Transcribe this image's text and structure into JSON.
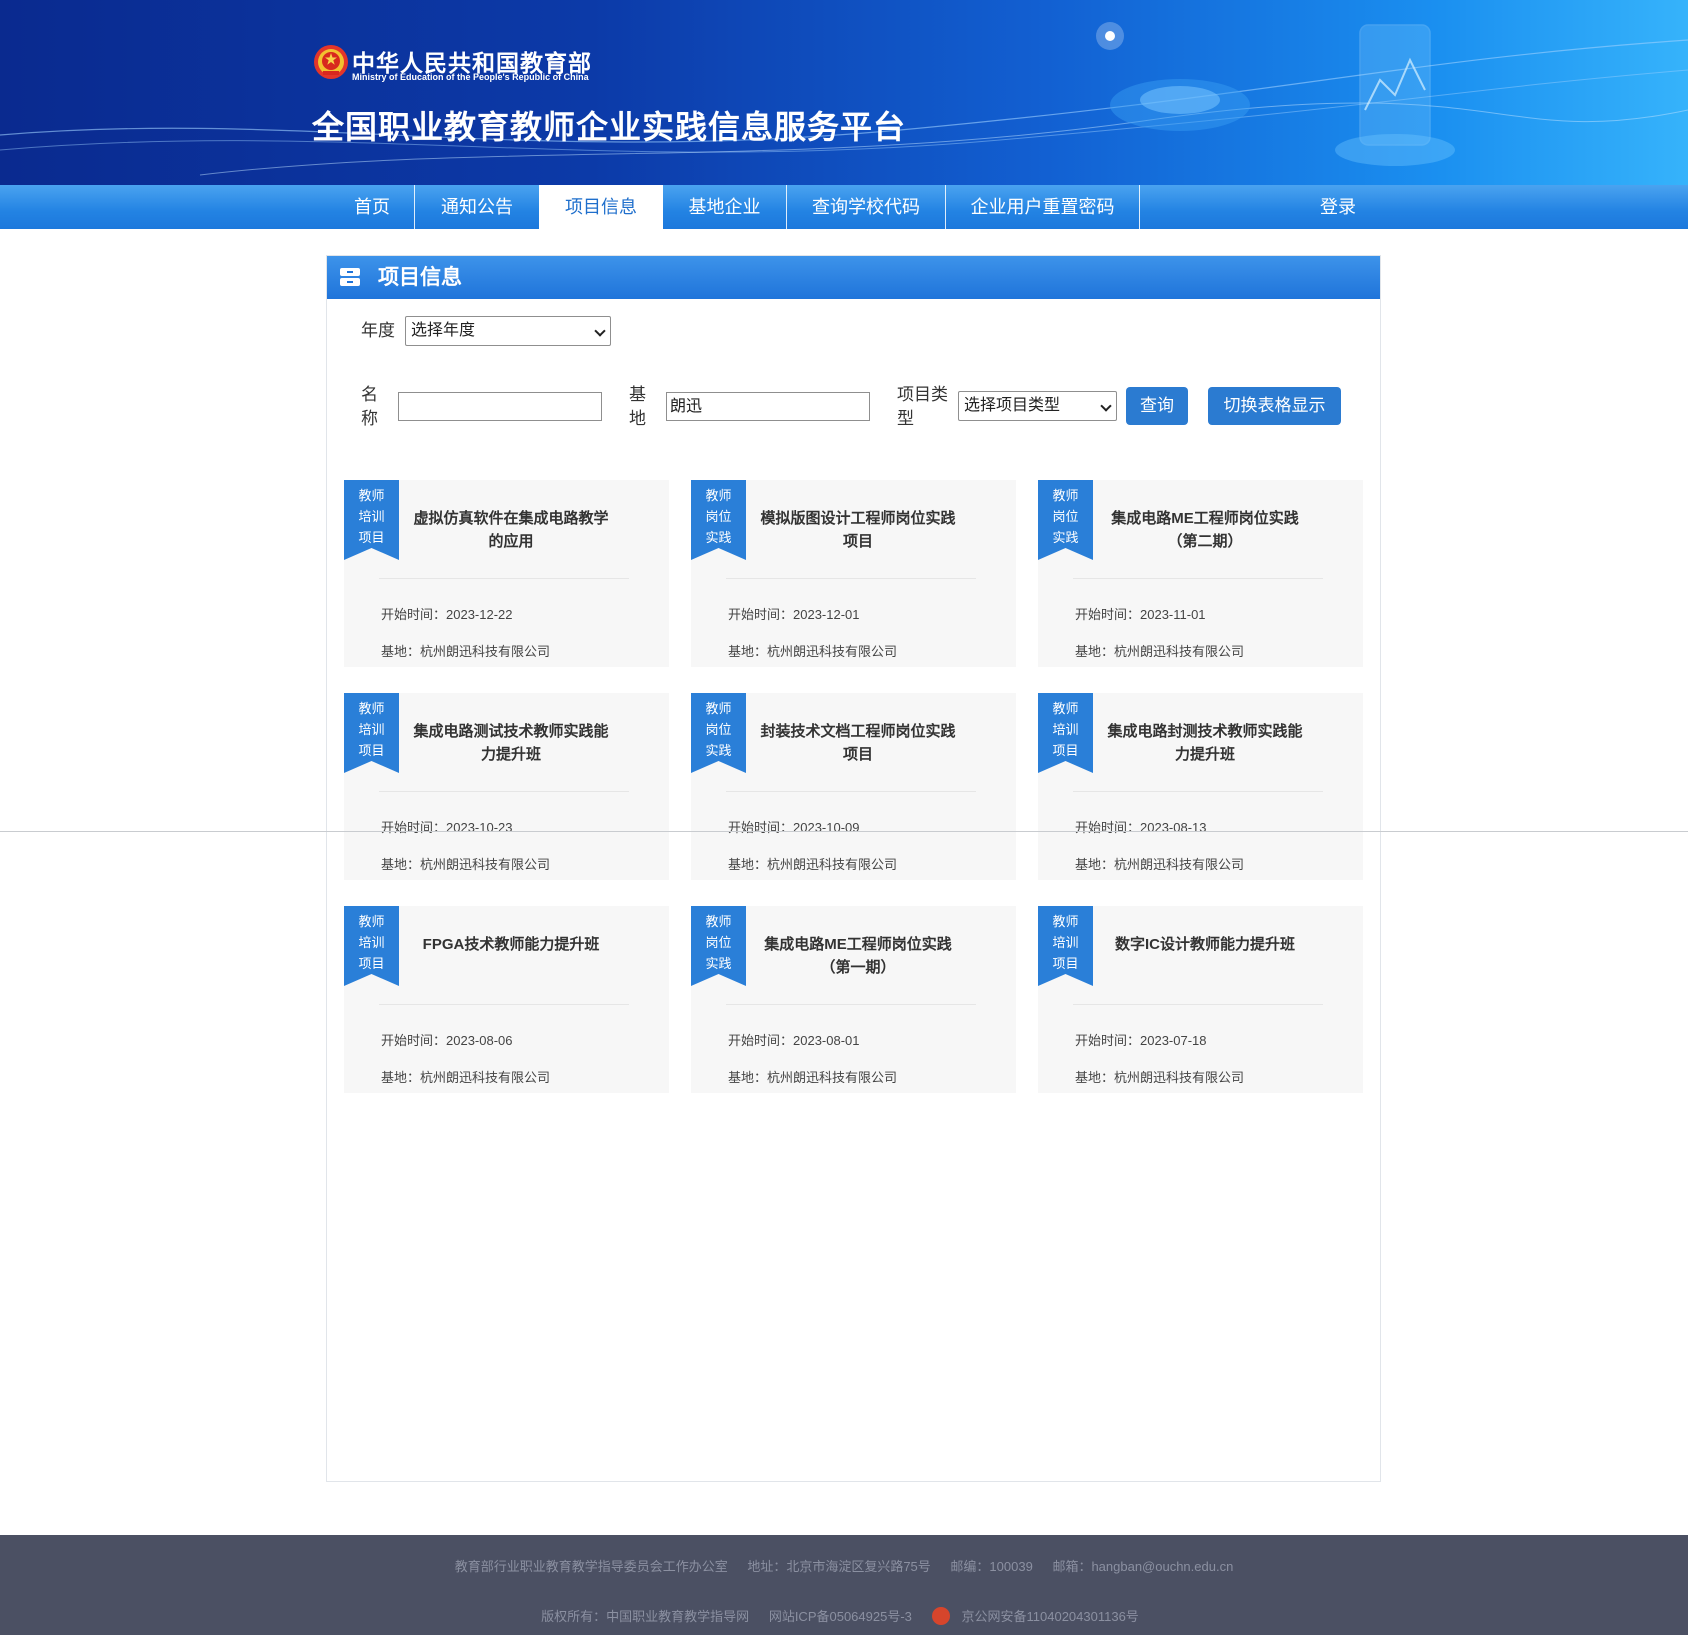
{
  "header": {
    "ministry_cn": "中华人民共和国教育部",
    "ministry_en": "Ministry of Education of the People's Republic of China",
    "platform_title": "全国职业教育教师企业实践信息服务平台"
  },
  "nav": {
    "items": [
      "首页",
      "通知公告",
      "项目信息",
      "基地企业",
      "查询学校代码",
      "企业用户重置密码"
    ],
    "active": "项目信息",
    "login": "登录"
  },
  "panel": {
    "title": "项目信息"
  },
  "filters": {
    "year_label": "年度",
    "year_value": "选择年度",
    "name_label_1": "名",
    "name_label_2": "称",
    "name_value": "",
    "base_label_1": "基",
    "base_label_2": "地",
    "base_value": "朗迅",
    "type_label_1": "项目类",
    "type_label_2": "型",
    "type_value": "选择项目类型",
    "query_button": "查询",
    "toggle_button": "切换表格显示"
  },
  "cards": [
    {
      "tag": [
        "教师",
        "培训",
        "项目"
      ],
      "title": "虚拟仿真软件在集成电路教学的应用",
      "start": "开始时间：2023-12-22",
      "base": "基地：杭州朗迅科技有限公司"
    },
    {
      "tag": [
        "教师",
        "岗位",
        "实践"
      ],
      "title": "模拟版图设计工程师岗位实践项目",
      "start": "开始时间：2023-12-01",
      "base": "基地：杭州朗迅科技有限公司"
    },
    {
      "tag": [
        "教师",
        "岗位",
        "实践"
      ],
      "title": "集成电路ME工程师岗位实践（第二期）",
      "start": "开始时间：2023-11-01",
      "base": "基地：杭州朗迅科技有限公司"
    },
    {
      "tag": [
        "教师",
        "培训",
        "项目"
      ],
      "title": "集成电路测试技术教师实践能力提升班",
      "start": "开始时间：2023-10-23",
      "base": "基地：杭州朗迅科技有限公司"
    },
    {
      "tag": [
        "教师",
        "岗位",
        "实践"
      ],
      "title": "封装技术文档工程师岗位实践项目",
      "start": "开始时间：2023-10-09",
      "base": "基地：杭州朗迅科技有限公司"
    },
    {
      "tag": [
        "教师",
        "培训",
        "项目"
      ],
      "title": "集成电路封测技术教师实践能力提升班",
      "start": "开始时间：2023-08-13",
      "base": "基地：杭州朗迅科技有限公司"
    },
    {
      "tag": [
        "教师",
        "培训",
        "项目"
      ],
      "title": "FPGA技术教师能力提升班",
      "start": "开始时间：2023-08-06",
      "base": "基地：杭州朗迅科技有限公司"
    },
    {
      "tag": [
        "教师",
        "岗位",
        "实践"
      ],
      "title": "集成电路ME工程师岗位实践（第一期）",
      "start": "开始时间：2023-08-01",
      "base": "基地：杭州朗迅科技有限公司"
    },
    {
      "tag": [
        "教师",
        "培训",
        "项目"
      ],
      "title": "数字IC设计教师能力提升班",
      "start": "开始时间：2023-07-18",
      "base": "基地：杭州朗迅科技有限公司"
    }
  ],
  "footer": {
    "office": "教育部行业职业教育教学指导委员会工作办公室",
    "address": "地址：北京市海淀区复兴路75号",
    "postcode": "邮编：100039",
    "email": "邮箱：hangban@ouchn.edu.cn",
    "copyright": "版权所有：中国职业教育教学指导网",
    "icp": "网站ICP备05064925号-3",
    "police": "京公网安备11040204301136号"
  },
  "colors": {
    "primary": "#1f74da",
    "button": "#2b7bd1",
    "footer_bg": "#4b5063",
    "card_bg": "#f7f7f7"
  }
}
